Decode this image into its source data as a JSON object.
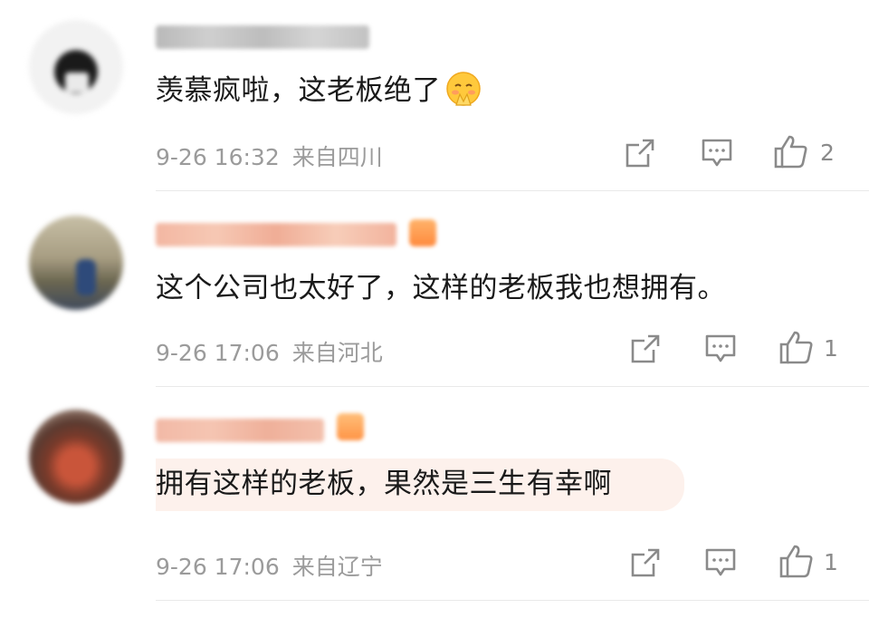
{
  "comments": [
    {
      "text": "羡慕疯啦，这老板绝了",
      "emoji": "pleading-hands-emoji",
      "time": "9-26 16:32",
      "location": "来自四川",
      "likes": "2"
    },
    {
      "text": "这个公司也太好了，这样的老板我也想拥有。",
      "time": "9-26 17:06",
      "location": "来自河北",
      "likes": "1"
    },
    {
      "text": "拥有这样的老板，果然是三生有幸啊",
      "time": "9-26 17:06",
      "location": "来自辽宁",
      "likes": "1"
    }
  ],
  "icons": {
    "share": "share-icon",
    "reply": "comment-icon",
    "like": "thumbs-up-icon"
  },
  "colors": {
    "highlight_bg": "#fdf1ec",
    "meta_text": "#9b9b9b",
    "icon": "#8a8a8a"
  }
}
